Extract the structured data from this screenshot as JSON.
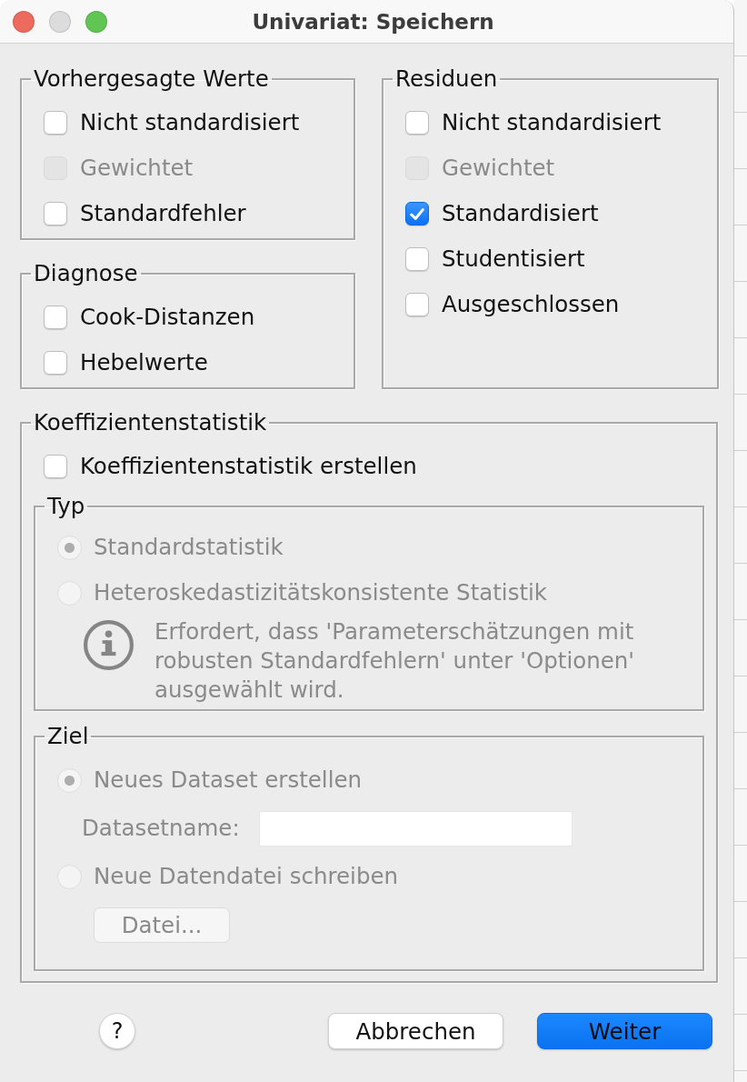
{
  "window": {
    "title": "Univariat: Speichern",
    "controls": [
      {
        "color": "#ed6a5e"
      },
      {
        "color": "#dcdcdc"
      },
      {
        "color": "#61c554"
      }
    ]
  },
  "predicted_values": {
    "title": "Vorhergesagte Werte",
    "items": [
      {
        "label": "Nicht standardisiert",
        "checked": false,
        "disabled": false
      },
      {
        "label": "Gewichtet",
        "checked": false,
        "disabled": true
      },
      {
        "label": "Standardfehler",
        "checked": false,
        "disabled": false
      }
    ]
  },
  "diagnostics": {
    "title": "Diagnose",
    "items": [
      {
        "label": "Cook-Distanzen",
        "checked": false,
        "disabled": false
      },
      {
        "label": "Hebelwerte",
        "checked": false,
        "disabled": false
      }
    ]
  },
  "residuals": {
    "title": "Residuen",
    "items": [
      {
        "label": "Nicht standardisiert",
        "checked": false,
        "disabled": false
      },
      {
        "label": "Gewichtet",
        "checked": false,
        "disabled": true
      },
      {
        "label": "Standardisiert",
        "checked": true,
        "disabled": false
      },
      {
        "label": "Studentisiert",
        "checked": false,
        "disabled": false
      },
      {
        "label": "Ausgeschlossen",
        "checked": false,
        "disabled": false
      }
    ]
  },
  "coefficient_statistics": {
    "title": "Koeffizientenstatistik",
    "create": {
      "label": "Koeffizientenstatistik erstellen",
      "checked": false,
      "disabled": false
    },
    "type": {
      "title": "Typ",
      "options": [
        {
          "label": "Standardstatistik",
          "selected": true,
          "disabled": true
        },
        {
          "label": "Heteroskedastizitätskonsistente Statistik",
          "selected": false,
          "disabled": true
        }
      ],
      "note": {
        "text": "Erfordert, dass 'Parameterschätzungen mit\nrobusten Standardfehlern' unter 'Optionen'\nausgewählt wird.",
        "disabled": true
      }
    },
    "destination": {
      "title": "Ziel",
      "options": [
        {
          "label": "Neues Dataset erstellen",
          "selected": true,
          "disabled": true,
          "field": {
            "label": "Datasetname:",
            "disabled": true
          }
        },
        {
          "label": "Neue Datendatei schreiben",
          "selected": false,
          "disabled": true,
          "button": {
            "label": "Datei...",
            "disabled": true
          }
        }
      ]
    }
  },
  "help": {
    "label": "?"
  },
  "buttons": [
    {
      "label": "Abbrechen",
      "kind": "secondary"
    },
    {
      "label": "Weiter",
      "kind": "primary"
    }
  ]
}
